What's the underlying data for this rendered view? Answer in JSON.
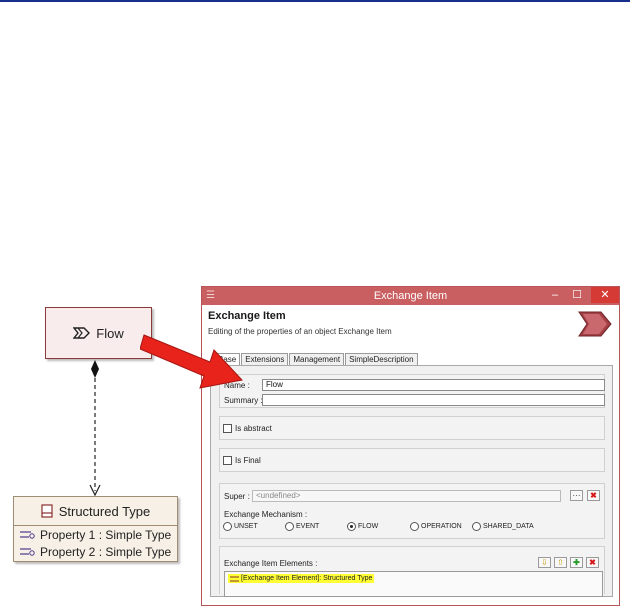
{
  "diagram": {
    "flow_label": "Flow",
    "struct_title": "Structured Type",
    "properties": [
      "Property 1 : Simple Type",
      "Property 2 : Simple Type"
    ]
  },
  "window": {
    "title": "Exchange Item",
    "minimize": "–",
    "maximize": "☐",
    "close": "✕",
    "header_title": "Exchange Item",
    "header_subtitle": "Editing of the properties of an object Exchange Item",
    "tabs": [
      "Base",
      "Extensions",
      "Management",
      "SimpleDescription"
    ],
    "name_label": "Name :",
    "name_value": "Flow",
    "summary_label": "Summary :",
    "summary_value": "",
    "abstract_label": "Is abstract",
    "final_label": "Is Final",
    "super_label": "Super :",
    "super_value": "<undefined>",
    "super_browse": "···",
    "super_clear": "✖",
    "mechanism_label": "Exchange Mechanism :",
    "mechanisms": [
      "UNSET",
      "EVENT",
      "FLOW",
      "OPERATION",
      "SHARED_DATA"
    ],
    "selected_mechanism": "FLOW",
    "elements_label": "Exchange Item Elements :",
    "element_item": "[Exchange Item Element]: Structured Type",
    "colors": {
      "titlebar": "#c95f61",
      "highlight": "#ffff33",
      "arrow": "#e8231b"
    }
  }
}
